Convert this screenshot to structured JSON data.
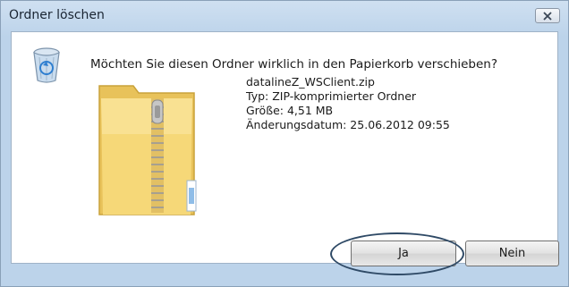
{
  "window": {
    "title": "Ordner löschen"
  },
  "dialog": {
    "question": "Möchten Sie diesen Ordner wirklich in den Papierkorb verschieben?",
    "file": {
      "name": "datalineZ_WSClient.zip",
      "type": "Typ: ZIP-komprimierter Ordner",
      "size": "Größe: 4,51 MB",
      "modified": "Änderungsdatum: 25.06.2012 09:55"
    }
  },
  "buttons": {
    "yes": "Ja",
    "no": "Nein"
  },
  "icons": {
    "close": "close-icon",
    "recycle_bin": "recycle-bin-icon",
    "zip_folder": "zip-folder-icon"
  },
  "colors": {
    "frame": "#bcd3ea",
    "highlight_ring": "#2f4a66"
  }
}
